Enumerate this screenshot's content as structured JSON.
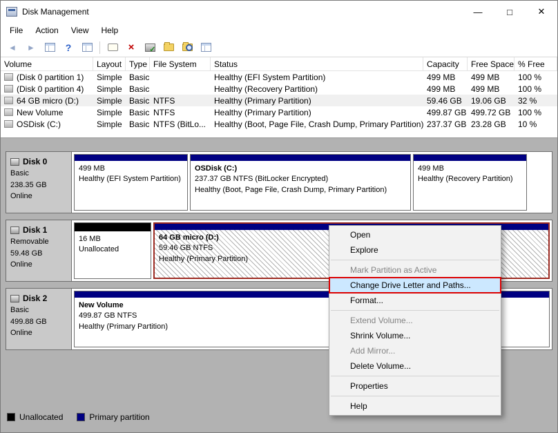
{
  "window": {
    "title": "Disk Management",
    "minimize": "—",
    "maximize": "□",
    "close": "✕"
  },
  "menu": {
    "items": [
      {
        "label": "File"
      },
      {
        "label": "Action"
      },
      {
        "label": "View"
      },
      {
        "label": "Help"
      }
    ]
  },
  "toolbar": {
    "icons": [
      {
        "name": "back-icon",
        "glyph": "◄"
      },
      {
        "name": "forward-icon",
        "glyph": "►"
      },
      {
        "name": "console-tree-icon"
      },
      {
        "name": "help-icon",
        "glyph": "?"
      },
      {
        "name": "action-pane-icon"
      },
      {
        "name": "properties-dialog-icon"
      },
      {
        "name": "delete-icon",
        "glyph": "×"
      },
      {
        "name": "disk-check-icon"
      },
      {
        "name": "folder-icon"
      },
      {
        "name": "folder-search-icon"
      },
      {
        "name": "list-view-icon"
      }
    ]
  },
  "volume_table": {
    "columns": [
      "Volume",
      "Layout",
      "Type",
      "File System",
      "Status",
      "Capacity",
      "Free Space",
      "% Free"
    ],
    "rows": [
      {
        "volume": "(Disk 0 partition 1)",
        "layout": "Simple",
        "type": "Basic",
        "file_system": "",
        "status": "Healthy (EFI System Partition)",
        "capacity": "499 MB",
        "free_space": "499 MB",
        "pct_free": "100 %"
      },
      {
        "volume": "(Disk 0 partition 4)",
        "layout": "Simple",
        "type": "Basic",
        "file_system": "",
        "status": "Healthy (Recovery Partition)",
        "capacity": "499 MB",
        "free_space": "499 MB",
        "pct_free": "100 %"
      },
      {
        "volume": "64 GB micro (D:)",
        "layout": "Simple",
        "type": "Basic",
        "file_system": "NTFS",
        "status": "Healthy (Primary Partition)",
        "capacity": "59.46 GB",
        "free_space": "19.06 GB",
        "pct_free": "32 %"
      },
      {
        "volume": "New Volume",
        "layout": "Simple",
        "type": "Basic",
        "file_system": "NTFS",
        "status": "Healthy (Primary Partition)",
        "capacity": "499.87 GB",
        "free_space": "499.72 GB",
        "pct_free": "100 %"
      },
      {
        "volume": "OSDisk (C:)",
        "layout": "Simple",
        "type": "Basic",
        "file_system": "NTFS (BitLo...",
        "status": "Healthy (Boot, Page File, Crash Dump, Primary Partition)",
        "capacity": "237.37 GB",
        "free_space": "23.28 GB",
        "pct_free": "10 %"
      }
    ]
  },
  "disks": [
    {
      "name": "Disk 0",
      "type": "Basic",
      "size": "238.35 GB",
      "status": "Online",
      "partitions": [
        {
          "line1": "499 MB",
          "line2": "Healthy (EFI System Partition)",
          "kind": "primary"
        },
        {
          "line1": "OSDisk  (C:)",
          "line2": "237.37 GB NTFS (BitLocker Encrypted)",
          "line3": "Healthy (Boot, Page File, Crash Dump, Primary Partition)",
          "kind": "primary"
        },
        {
          "line1": "499 MB",
          "line2": "Healthy (Recovery Partition)",
          "kind": "primary"
        }
      ]
    },
    {
      "name": "Disk 1",
      "type": "Removable",
      "size": "59.48 GB",
      "status": "Online",
      "partitions": [
        {
          "line1": "16 MB",
          "line2": "Unallocated",
          "kind": "unallocated"
        },
        {
          "line1": "64 GB micro  (D:)",
          "line2": "59.46 GB NTFS",
          "line3": "Healthy (Primary Partition)",
          "kind": "primary",
          "selected": true
        }
      ]
    },
    {
      "name": "Disk 2",
      "type": "Basic",
      "size": "499.88 GB",
      "status": "Online",
      "partitions": [
        {
          "line1": "New Volume",
          "line2": "499.87 GB NTFS",
          "line3": "Healthy (Primary Partition)",
          "kind": "primary"
        }
      ]
    }
  ],
  "context_menu": {
    "items": [
      {
        "label": "Open",
        "enabled": true
      },
      {
        "label": "Explore",
        "enabled": true
      },
      {
        "type": "separator"
      },
      {
        "label": "Mark Partition as Active",
        "enabled": false
      },
      {
        "label": "Change Drive Letter and Paths...",
        "enabled": true,
        "highlighted": true
      },
      {
        "label": "Format...",
        "enabled": true
      },
      {
        "type": "separator"
      },
      {
        "label": "Extend Volume...",
        "enabled": false
      },
      {
        "label": "Shrink Volume...",
        "enabled": true
      },
      {
        "label": "Add Mirror...",
        "enabled": false
      },
      {
        "label": "Delete Volume...",
        "enabled": true
      },
      {
        "type": "separator"
      },
      {
        "label": "Properties",
        "enabled": true
      },
      {
        "type": "separator"
      },
      {
        "label": "Help",
        "enabled": true
      }
    ]
  },
  "legend": {
    "items": [
      {
        "label": "Unallocated",
        "color": "#000000"
      },
      {
        "label": "Primary partition",
        "color": "#000082"
      }
    ]
  },
  "colors": {
    "partition_header": "#000082",
    "unallocated": "#000000",
    "selection_border": "#9c2a21",
    "menu_highlight": "#cce8ff",
    "annotation_red": "#dc0000"
  }
}
